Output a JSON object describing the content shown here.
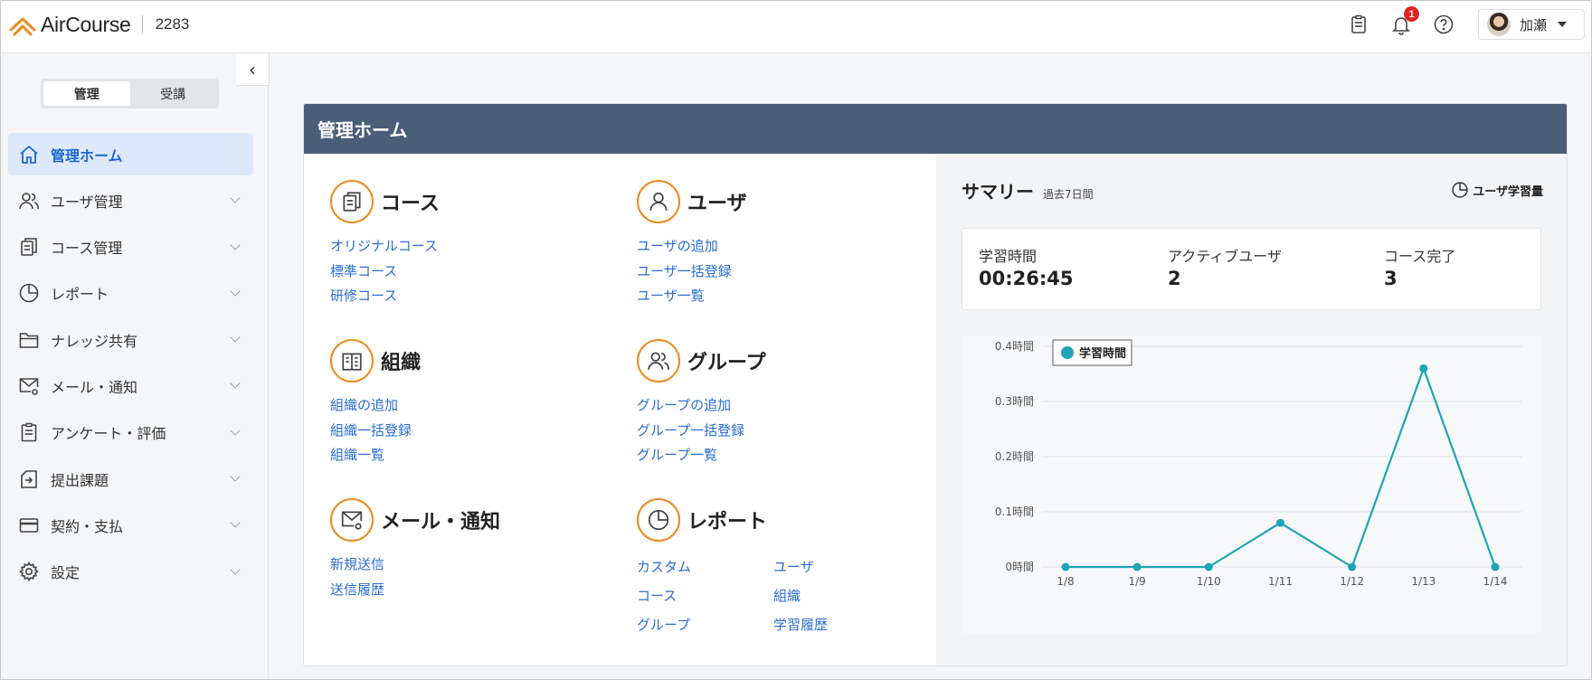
{
  "header": {
    "brand": "AirCourse",
    "tenant_id": "2283",
    "notification_count": "1",
    "user_name": "加瀬"
  },
  "sidebar": {
    "mode_tabs": [
      {
        "label": "管理",
        "active": true
      },
      {
        "label": "受講",
        "active": false
      }
    ],
    "items": [
      {
        "label": "管理ホーム",
        "icon": "home-icon",
        "active": true
      },
      {
        "label": "ユーザ管理",
        "icon": "users-icon"
      },
      {
        "label": "コース管理",
        "icon": "copy-icon"
      },
      {
        "label": "レポート",
        "icon": "pie-chart-icon"
      },
      {
        "label": "ナレッジ共有",
        "icon": "folder-icon"
      },
      {
        "label": "メール・通知",
        "icon": "mail-gear-icon"
      },
      {
        "label": "アンケート・評価",
        "icon": "clipboard-icon"
      },
      {
        "label": "提出課題",
        "icon": "submit-icon"
      },
      {
        "label": "契約・支払",
        "icon": "credit-card-icon"
      },
      {
        "label": "設定",
        "icon": "gear-icon"
      }
    ]
  },
  "main": {
    "title": "管理ホーム",
    "sections": {
      "course": {
        "title": "コース",
        "links": [
          "オリジナルコース",
          "標準コース",
          "研修コース"
        ]
      },
      "user": {
        "title": "ユーザ",
        "links": [
          "ユーザの追加",
          "ユーザ一括登録",
          "ユーザ一覧"
        ]
      },
      "org": {
        "title": "組織",
        "links": [
          "組織の追加",
          "組織一括登録",
          "組織一覧"
        ]
      },
      "group": {
        "title": "グループ",
        "links": [
          "グループの追加",
          "グループ一括登録",
          "グループ一覧"
        ]
      },
      "mail": {
        "title": "メール・通知",
        "links": [
          "新規送信",
          "送信履歴"
        ]
      },
      "report": {
        "title": "レポート",
        "links": [
          "カスタム",
          "ユーザ",
          "コース",
          "組織",
          "グループ",
          "学習履歴"
        ]
      }
    }
  },
  "summary": {
    "title": "サマリー",
    "period": "過去7日間",
    "link_label": "ユーザ学習量",
    "stats": [
      {
        "label": "学習時間",
        "value": "00:26:45"
      },
      {
        "label": "アクティブユーザ",
        "value": "2"
      },
      {
        "label": "コース完了",
        "value": "3"
      }
    ]
  },
  "colors": {
    "accent": "#ee8a1f",
    "link": "#2a6ed0",
    "header_bar": "#4a5e77",
    "series": "#1fa3b8",
    "badge": "#e02424"
  },
  "chart_data": {
    "type": "line",
    "categories": [
      "1/8",
      "1/9",
      "1/10",
      "1/11",
      "1/12",
      "1/13",
      "1/14"
    ],
    "series": [
      {
        "name": "学習時間",
        "values": [
          0,
          0,
          0,
          0.08,
          0,
          0.36,
          0
        ]
      }
    ],
    "yticks": [
      "0時間",
      "0.1時間",
      "0.2時間",
      "0.3時間",
      "0.4時間"
    ],
    "ylim": [
      0,
      0.4
    ],
    "grid": true,
    "legend": "top-left"
  }
}
